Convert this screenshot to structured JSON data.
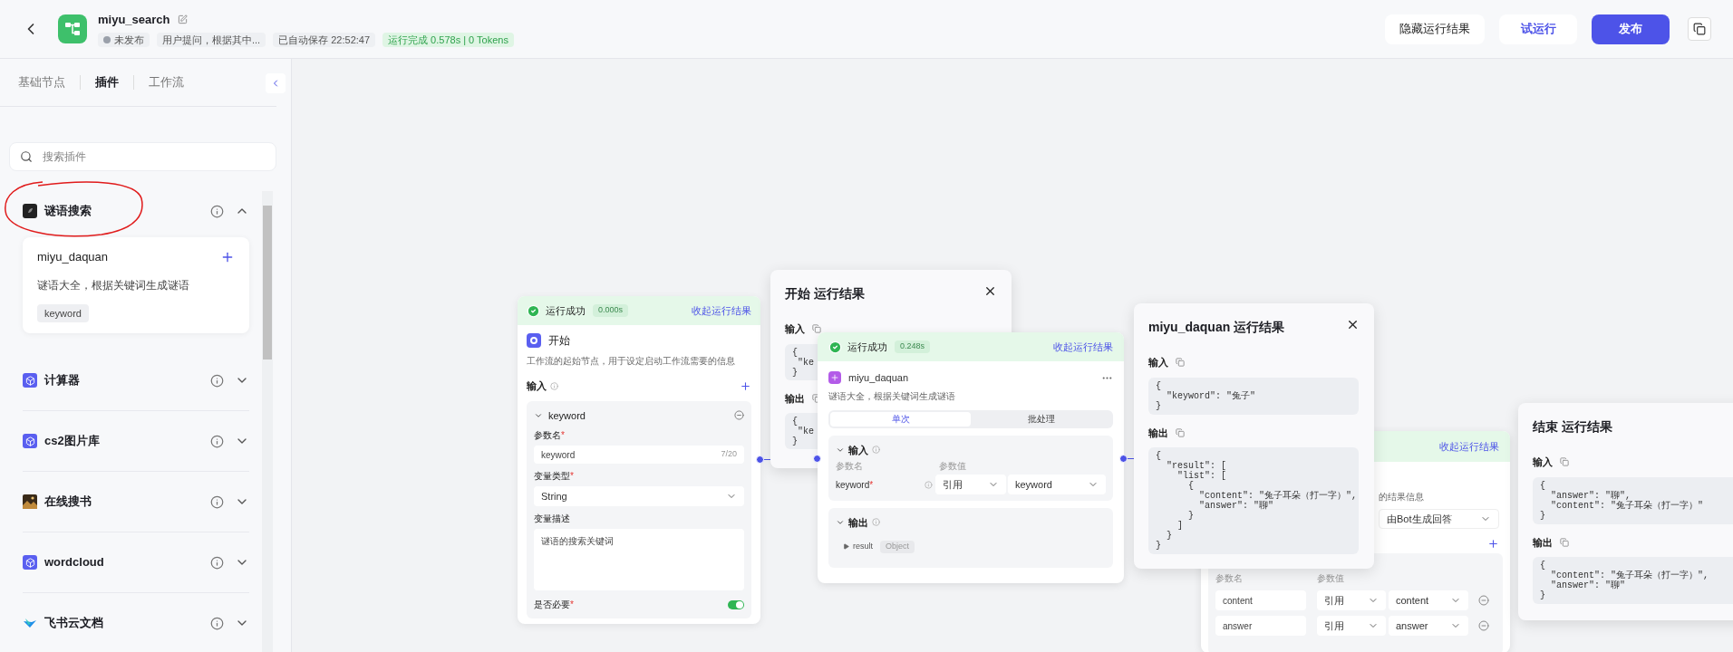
{
  "topbar": {
    "title": "miyu_search",
    "status": "未发布",
    "description": "用户提问，根据其中...",
    "saved": "已自动保存 22:52:47",
    "run_badge": "运行完成 0.578s | 0 Tokens",
    "buttons": [
      {
        "label": "隐藏运行结果",
        "kind": "plain"
      },
      {
        "label": "试运行",
        "kind": "outline"
      },
      {
        "label": "发布",
        "kind": "primary"
      }
    ]
  },
  "sidebar": {
    "tabs": [
      {
        "label": "基础节点",
        "selected": false
      },
      {
        "label": "插件",
        "selected": true
      },
      {
        "label": "工作流",
        "selected": false
      }
    ],
    "search": {
      "placeholder": "搜索插件"
    },
    "plugins": [
      {
        "name": "谜语搜索",
        "kind": "leaf",
        "expanded": true,
        "tools": [
          {
            "name": "miyu_daquan",
            "description": "谜语大全，根据关键词生成谜语",
            "params": [
              "keyword"
            ]
          }
        ]
      },
      {
        "name": "计算器",
        "kind": "cube",
        "expanded": false
      },
      {
        "name": "cs2图片库",
        "kind": "cube",
        "expanded": false
      },
      {
        "name": "在线搜书",
        "kind": "photo",
        "expanded": false
      },
      {
        "name": "wordcloud",
        "kind": "cube",
        "expanded": false
      },
      {
        "name": "飞书云文档",
        "kind": "wing",
        "expanded": false
      }
    ]
  },
  "canvas": {
    "start_node": {
      "status": "运行成功",
      "time": "0.000s",
      "collapse": "收起运行结果",
      "title": "开始",
      "description": "工作流的起始节点，用于设定启动工作流需要的信息",
      "input_label": "输入",
      "param": {
        "name": "keyword",
        "expanded": true,
        "name_label": {
          "text": "参数名",
          "mark": "*"
        },
        "name_value": "keyword",
        "counter": "7/20",
        "type_label": {
          "text": "变量类型",
          "mark": "*"
        },
        "type_value": "String",
        "desc_label": {
          "text": "变量描述"
        },
        "desc_value": "谜语的搜索关键词",
        "required_label": {
          "text": "是否必要",
          "mark": "*"
        },
        "required": true
      }
    },
    "start_result": {
      "title": "开始 运行结果",
      "input_label": "输入",
      "input_code": [
        "{",
        " \"ke",
        "}"
      ],
      "output_label": "输出",
      "output_code": [
        "{",
        " \"ke",
        "}"
      ]
    },
    "plugin_node": {
      "status": "运行成功",
      "time": "0.248s",
      "collapse": "收起运行结果",
      "title": "miyu_daquan",
      "description": "谜语大全，根据关键词生成谜语",
      "modes": [
        {
          "label": "单次",
          "selected": true
        },
        {
          "label": "批处理",
          "selected": false
        }
      ],
      "input": {
        "label": "输入",
        "expanded": true,
        "name_header": "参数名",
        "value_header": "参数值",
        "rows": [
          {
            "name": "keyword",
            "mark": "*",
            "source": "引用",
            "value": "keyword"
          }
        ]
      },
      "output": {
        "label": "输出",
        "expanded": true,
        "fields": [
          {
            "name": "result",
            "type": "Object"
          }
        ]
      }
    },
    "plugin_result": {
      "title": "miyu_daquan 运行结果",
      "input_label": "输入",
      "input_code": [
        "{",
        "  \"keyword\": \"兔子\"",
        "}"
      ],
      "output_label": "输出",
      "output_code": [
        "{",
        "  \"result\": [",
        "    \"list\": [",
        "      {",
        "        \"content\": \"兔子耳朵（打一字）\",",
        "        \"answer\": \"聊\"",
        "      }",
        "    ]",
        "  }",
        "}"
      ]
    },
    "end_node": {
      "collapse": "收起运行结果",
      "description": "的结果信息",
      "answer_mode": "由Bot生成回答",
      "name_header": "参数名",
      "value_header": "参数值",
      "rows": [
        {
          "name": "content",
          "source": "引用",
          "value": "content"
        },
        {
          "name": "answer",
          "source": "引用",
          "value": "answer"
        }
      ]
    },
    "end_result": {
      "title": "结束 运行结果",
      "input_label": "输入",
      "input_code": [
        "{",
        "  \"answer\": \"聊\",",
        "  \"content\": \"兔子耳朵（打一字）\"",
        "}"
      ],
      "output_label": "输出",
      "output_code": [
        "{",
        "  \"content\": \"兔子耳朵（打一字）\",",
        "  \"answer\": \"聊\"",
        "}"
      ]
    }
  }
}
